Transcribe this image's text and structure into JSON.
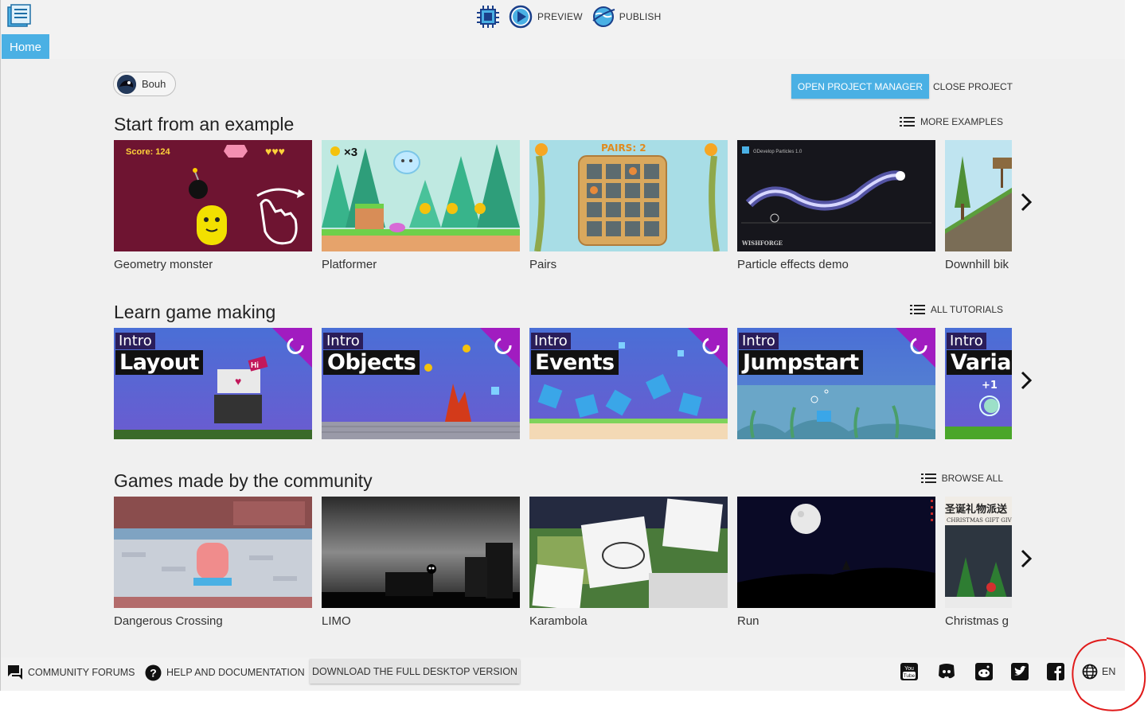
{
  "toolbar": {
    "preview_label": "PREVIEW",
    "publish_label": "PUBLISH",
    "accent": "#4ab0e4"
  },
  "tabs": {
    "home_label": "Home"
  },
  "user": {
    "name": "Bouh"
  },
  "project": {
    "open_manager_label": "OPEN PROJECT MANAGER",
    "close_label": "CLOSE PROJECT"
  },
  "sections": {
    "examples": {
      "title": "Start from an example",
      "link_label": "MORE EXAMPLES",
      "items": [
        "Geometry monster",
        "Platformer",
        "Pairs",
        "Particle effects demo",
        "Downhill bik"
      ]
    },
    "tutorials": {
      "title": "Learn game making",
      "link_label": "ALL TUTORIALS",
      "items": [
        {
          "tag": "Intro",
          "title": "Layout"
        },
        {
          "tag": "Intro",
          "title": "Objects"
        },
        {
          "tag": "Intro",
          "title": "Events"
        },
        {
          "tag": "Intro",
          "title": "Jumpstart"
        },
        {
          "tag": "Intro",
          "title": "Variab"
        }
      ]
    },
    "community": {
      "title": "Games made by the community",
      "link_label": "BROWSE ALL",
      "items": [
        "Dangerous Crossing",
        "LIMO",
        "Karambola",
        "Run",
        "Christmas g"
      ]
    }
  },
  "thumb_text": {
    "score": "Score: 124",
    "coins": "×3",
    "pairs": "PAIRS: 2",
    "particles_title": "GDevelop Particles 1.0",
    "particles_brand": "WISHFORGE",
    "plus_one": "+1",
    "hi": "Hi",
    "xmas_chinese": "圣诞礼物派送",
    "xmas_english": "CHRISTMAS GIFT GIV"
  },
  "footer": {
    "forums_label": "COMMUNITY FORUMS",
    "help_label": "HELP AND DOCUMENTATION",
    "download_label": "DOWNLOAD THE FULL DESKTOP VERSION",
    "language": "EN",
    "social": [
      "youtube-icon",
      "discord-icon",
      "reddit-icon",
      "twitter-icon",
      "facebook-icon"
    ]
  }
}
